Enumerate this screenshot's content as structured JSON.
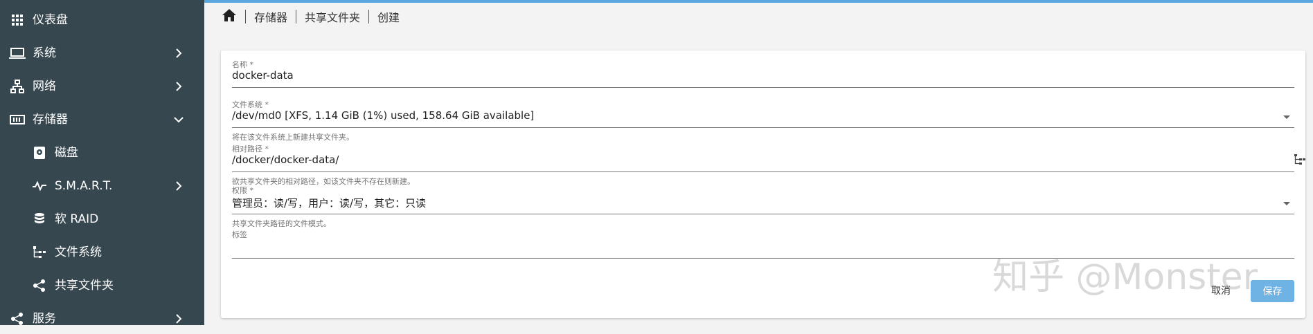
{
  "sidebar": {
    "items": [
      {
        "label": "仪表盘",
        "icon": "dashboard-grid-icon"
      },
      {
        "label": "系统",
        "icon": "laptop-icon"
      },
      {
        "label": "网络",
        "icon": "network-icon"
      },
      {
        "label": "存储器",
        "icon": "storage-icon"
      },
      {
        "label": "磁盘",
        "icon": "disk-icon"
      },
      {
        "label": "S.M.A.R.T.",
        "icon": "pulse-icon"
      },
      {
        "label": "软 RAID",
        "icon": "database-icon"
      },
      {
        "label": "文件系统",
        "icon": "file-tree-icon"
      },
      {
        "label": "共享文件夹",
        "icon": "share-icon"
      },
      {
        "label": "服务",
        "icon": "share-icon"
      }
    ]
  },
  "breadcrumb": [
    "存储器",
    "共享文件夹",
    "创建"
  ],
  "form": {
    "name": {
      "label": "名称 *",
      "value": "docker-data"
    },
    "filesystem": {
      "label": "文件系统 *",
      "value": "/dev/md0 [XFS, 1.14 GiB (1%) used, 158.64 GiB available]",
      "hint": "将在该文件系统上新建共享文件夹。"
    },
    "relpath": {
      "label": "相对路径 *",
      "value": "/docker/docker-data/",
      "hint": "欲共享文件夹的相对路径，如该文件夹不存在则新建。"
    },
    "permissions": {
      "label": "权限 *",
      "value": "管理员：读/写，用户：读/写，其它：只读",
      "hint": "共享文件夹路径的文件模式。"
    },
    "tags": {
      "label": "标签",
      "value": ""
    }
  },
  "buttons": {
    "cancel": "取消",
    "save": "保存"
  },
  "watermark": "知乎 @Monster",
  "colors": {
    "sidebar": "#37474f",
    "accent": "#5aa6df",
    "save_button": "#6fb2e4"
  }
}
